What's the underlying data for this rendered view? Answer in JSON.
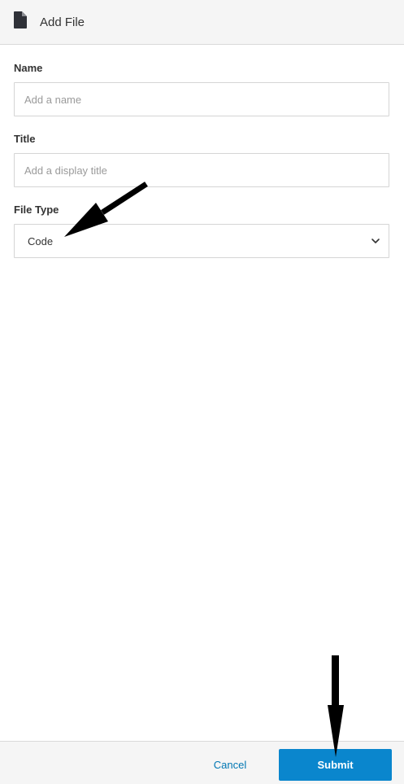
{
  "header": {
    "title": "Add File",
    "icon": "document-icon"
  },
  "form": {
    "name": {
      "label": "Name",
      "value": "",
      "placeholder": "Add a name"
    },
    "title": {
      "label": "Title",
      "value": "",
      "placeholder": "Add a display title"
    },
    "file_type": {
      "label": "File Type",
      "selected": "Code"
    }
  },
  "footer": {
    "cancel_label": "Cancel",
    "submit_label": "Submit"
  },
  "colors": {
    "accent": "#0a86cd",
    "link": "#0077b3",
    "header_bg": "#f5f5f5"
  }
}
